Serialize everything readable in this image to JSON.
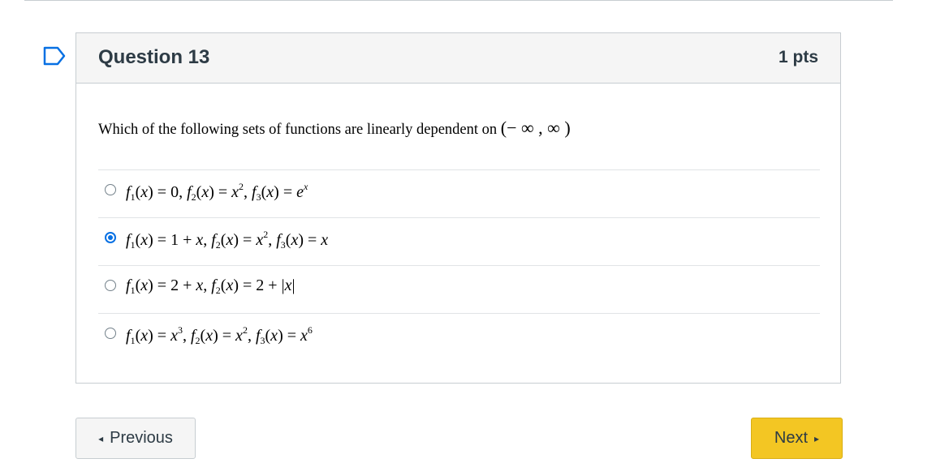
{
  "question": {
    "title": "Question 13",
    "points": "1 pts",
    "text": "Which of the following sets of functions are linearly dependent on",
    "interval": "(− ∞ , ∞ )"
  },
  "answers": [
    {
      "selected": false,
      "expr": "f1(x) = 0, f2(x) = x^2, f3(x) = e^x"
    },
    {
      "selected": true,
      "expr": "f1(x) = 1 + x, f2(x) = x^2, f3(x) = x"
    },
    {
      "selected": false,
      "expr": "f1(x) = 2 + x, f2(x) = 2 + |x|"
    },
    {
      "selected": false,
      "expr": "f1(x) = x^3, f2(x) = x^2, f3(x) = x^6"
    }
  ],
  "navigation": {
    "previous_label": "Previous",
    "next_label": "Next",
    "previous_icon": "◂",
    "next_icon": "▸"
  },
  "colors": {
    "accent_blue": "#0770e3",
    "next_button": "#f3c623",
    "flag_outline": "#0770e3"
  }
}
